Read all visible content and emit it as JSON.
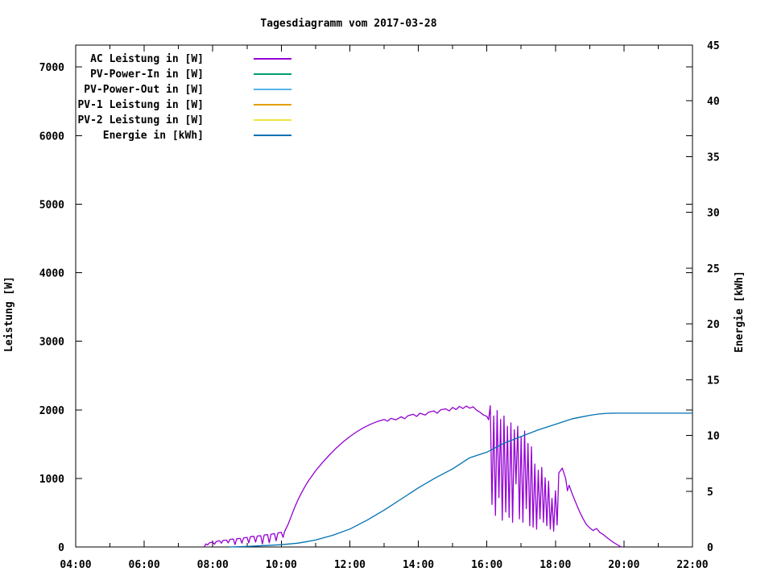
{
  "window": {
    "background": "#ffffff",
    "foreground": "#000000"
  },
  "chart_data": {
    "type": "line",
    "title": "Tagesdiagramm vom 2017-03-28",
    "grid": false,
    "legend_position": "top-left-inside",
    "x_axis": {
      "start_hour": 4,
      "end_hour": 22,
      "major_step_hours": 2,
      "minor_step_hours": 1,
      "tick_labels": [
        "04:00",
        "06:00",
        "08:00",
        "10:00",
        "12:00",
        "14:00",
        "16:00",
        "18:00",
        "20:00",
        "22:00"
      ]
    },
    "y_left": {
      "label": "Leistung [W]",
      "range": [
        0,
        7320
      ],
      "ticks": [
        0,
        1000,
        2000,
        3000,
        4000,
        5000,
        6000,
        7000
      ]
    },
    "y_right": {
      "label": "Energie [kWh]",
      "range": [
        0,
        45
      ],
      "ticks": [
        0,
        5,
        10,
        15,
        20,
        25,
        30,
        35,
        40,
        45
      ]
    },
    "series": [
      {
        "name": "AC Leistung in [W]",
        "color": "#9400d3",
        "axis": "left",
        "points": [
          [
            7.75,
            0
          ],
          [
            7.8,
            45
          ],
          [
            7.85,
            30
          ],
          [
            7.9,
            60
          ],
          [
            8.0,
            70
          ],
          [
            8.05,
            40
          ],
          [
            8.1,
            80
          ],
          [
            8.2,
            90
          ],
          [
            8.25,
            55
          ],
          [
            8.3,
            95
          ],
          [
            8.4,
            100
          ],
          [
            8.45,
            60
          ],
          [
            8.5,
            110
          ],
          [
            8.6,
            115
          ],
          [
            8.65,
            35
          ],
          [
            8.7,
            120
          ],
          [
            8.8,
            125
          ],
          [
            8.85,
            55
          ],
          [
            8.9,
            130
          ],
          [
            9.0,
            140
          ],
          [
            9.05,
            60
          ],
          [
            9.1,
            150
          ],
          [
            9.2,
            155
          ],
          [
            9.25,
            70
          ],
          [
            9.3,
            160
          ],
          [
            9.4,
            165
          ],
          [
            9.45,
            45
          ],
          [
            9.5,
            175
          ],
          [
            9.6,
            180
          ],
          [
            9.65,
            60
          ],
          [
            9.7,
            185
          ],
          [
            9.8,
            195
          ],
          [
            9.85,
            90
          ],
          [
            9.9,
            205
          ],
          [
            10.0,
            215
          ],
          [
            10.05,
            140
          ],
          [
            10.1,
            230
          ],
          [
            10.2,
            330
          ],
          [
            10.3,
            460
          ],
          [
            10.4,
            590
          ],
          [
            10.5,
            700
          ],
          [
            10.6,
            800
          ],
          [
            10.7,
            890
          ],
          [
            10.8,
            970
          ],
          [
            10.9,
            1040
          ],
          [
            11.0,
            1110
          ],
          [
            11.2,
            1230
          ],
          [
            11.4,
            1340
          ],
          [
            11.6,
            1440
          ],
          [
            11.8,
            1530
          ],
          [
            12.0,
            1610
          ],
          [
            12.2,
            1680
          ],
          [
            12.4,
            1740
          ],
          [
            12.6,
            1790
          ],
          [
            12.8,
            1830
          ],
          [
            13.0,
            1860
          ],
          [
            13.1,
            1835
          ],
          [
            13.2,
            1875
          ],
          [
            13.35,
            1855
          ],
          [
            13.5,
            1900
          ],
          [
            13.6,
            1870
          ],
          [
            13.7,
            1915
          ],
          [
            13.85,
            1935
          ],
          [
            13.95,
            1905
          ],
          [
            14.05,
            1950
          ],
          [
            14.2,
            1925
          ],
          [
            14.3,
            1965
          ],
          [
            14.45,
            1985
          ],
          [
            14.55,
            1950
          ],
          [
            14.65,
            2000
          ],
          [
            14.8,
            2015
          ],
          [
            14.9,
            1985
          ],
          [
            15.0,
            2035
          ],
          [
            15.1,
            2005
          ],
          [
            15.2,
            2050
          ],
          [
            15.3,
            2020
          ],
          [
            15.4,
            2055
          ],
          [
            15.5,
            2025
          ],
          [
            15.6,
            2045
          ],
          [
            15.7,
            1995
          ],
          [
            15.8,
            1965
          ],
          [
            15.9,
            1925
          ],
          [
            16.0,
            1905
          ],
          [
            16.05,
            1855
          ],
          [
            16.1,
            2060
          ],
          [
            16.15,
            620
          ],
          [
            16.2,
            1910
          ],
          [
            16.25,
            460
          ],
          [
            16.3,
            1990
          ],
          [
            16.35,
            720
          ],
          [
            16.4,
            1860
          ],
          [
            16.45,
            390
          ],
          [
            16.5,
            1910
          ],
          [
            16.55,
            510
          ],
          [
            16.6,
            1760
          ],
          [
            16.65,
            430
          ],
          [
            16.7,
            1810
          ],
          [
            16.75,
            360
          ],
          [
            16.8,
            1710
          ],
          [
            16.85,
            920
          ],
          [
            16.9,
            1760
          ],
          [
            16.95,
            410
          ],
          [
            17.0,
            1610
          ],
          [
            17.05,
            360
          ],
          [
            17.1,
            1690
          ],
          [
            17.15,
            560
          ],
          [
            17.2,
            1510
          ],
          [
            17.25,
            310
          ],
          [
            17.3,
            1460
          ],
          [
            17.35,
            290
          ],
          [
            17.4,
            1210
          ],
          [
            17.45,
            260
          ],
          [
            17.5,
            1120
          ],
          [
            17.55,
            410
          ],
          [
            17.6,
            1160
          ],
          [
            17.65,
            360
          ],
          [
            17.7,
            1010
          ],
          [
            17.75,
            310
          ],
          [
            17.8,
            960
          ],
          [
            17.85,
            260
          ],
          [
            17.9,
            710
          ],
          [
            17.95,
            230
          ],
          [
            18.0,
            820
          ],
          [
            18.05,
            320
          ],
          [
            18.1,
            1080
          ],
          [
            18.2,
            1150
          ],
          [
            18.3,
            1000
          ],
          [
            18.35,
            820
          ],
          [
            18.4,
            900
          ],
          [
            18.5,
            760
          ],
          [
            18.6,
            640
          ],
          [
            18.7,
            520
          ],
          [
            18.8,
            420
          ],
          [
            18.9,
            330
          ],
          [
            19.0,
            280
          ],
          [
            19.1,
            240
          ],
          [
            19.2,
            270
          ],
          [
            19.3,
            210
          ],
          [
            19.4,
            180
          ],
          [
            19.5,
            140
          ],
          [
            19.6,
            100
          ],
          [
            19.7,
            65
          ],
          [
            19.8,
            35
          ],
          [
            19.9,
            5
          ],
          [
            19.95,
            0
          ]
        ]
      },
      {
        "name": "PV-Power-In in [W]",
        "color": "#009e73",
        "axis": "left",
        "points": []
      },
      {
        "name": "PV-Power-Out in [W]",
        "color": "#56b4e9",
        "axis": "left",
        "points": []
      },
      {
        "name": "PV-1 Leistung in [W]",
        "color": "#e69f00",
        "axis": "left",
        "points": []
      },
      {
        "name": "PV-2 Leistung in [W]",
        "color": "#f0e442",
        "axis": "left",
        "points": []
      },
      {
        "name": "Energie in [kWh]",
        "color": "#0072b2",
        "axis": "right",
        "points": [
          [
            8.5,
            0
          ],
          [
            9.0,
            0.05
          ],
          [
            9.5,
            0.12
          ],
          [
            10.0,
            0.2
          ],
          [
            10.5,
            0.35
          ],
          [
            11.0,
            0.62
          ],
          [
            11.5,
            1.05
          ],
          [
            12.0,
            1.6
          ],
          [
            12.5,
            2.4
          ],
          [
            13.0,
            3.3
          ],
          [
            13.5,
            4.3
          ],
          [
            14.0,
            5.3
          ],
          [
            14.5,
            6.2
          ],
          [
            15.0,
            7.0
          ],
          [
            15.5,
            8.0
          ],
          [
            16.0,
            8.5
          ],
          [
            16.5,
            9.3
          ],
          [
            17.0,
            9.9
          ],
          [
            17.5,
            10.5
          ],
          [
            18.0,
            11.0
          ],
          [
            18.25,
            11.25
          ],
          [
            18.5,
            11.5
          ],
          [
            18.75,
            11.65
          ],
          [
            19.0,
            11.8
          ],
          [
            19.25,
            11.92
          ],
          [
            19.5,
            11.98
          ],
          [
            19.75,
            12.0
          ],
          [
            20.0,
            12.0
          ],
          [
            21.0,
            12.0
          ],
          [
            22.0,
            12.0
          ]
        ]
      }
    ]
  }
}
